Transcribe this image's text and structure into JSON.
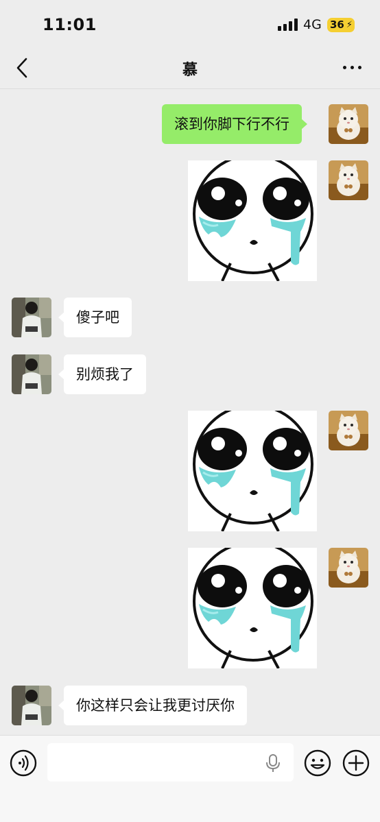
{
  "status_bar": {
    "time": "11:01",
    "network": "4G",
    "battery": "36"
  },
  "header": {
    "title": "慕",
    "back_icon": "chevron-left-icon",
    "more_icon": "ellipsis-icon"
  },
  "messages": [
    {
      "side": "out",
      "type": "text",
      "text": "滚到你脚下行不行"
    },
    {
      "side": "out",
      "type": "sticker",
      "sticker": "crying-face-sticker"
    },
    {
      "side": "in",
      "type": "text",
      "text": "傻子吧"
    },
    {
      "side": "in",
      "type": "text",
      "text": "别烦我了"
    },
    {
      "side": "out",
      "type": "sticker",
      "sticker": "crying-face-sticker"
    },
    {
      "side": "out",
      "type": "sticker",
      "sticker": "crying-face-sticker"
    },
    {
      "side": "in",
      "type": "text",
      "text": "你这样只会让我更讨厌你"
    }
  ],
  "input_bar": {
    "placeholder": "",
    "voice_icon": "voice-icon",
    "mic_icon": "microphone-icon",
    "emoji_icon": "emoji-icon",
    "plus_icon": "plus-icon"
  },
  "colors": {
    "background": "#ededed",
    "outgoing_bubble": "#95ec69",
    "incoming_bubble": "#ffffff",
    "battery": "#f5cf32"
  }
}
